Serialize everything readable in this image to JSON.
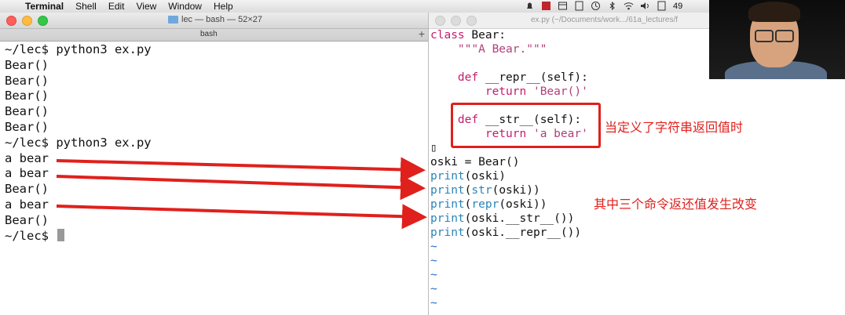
{
  "menubar": {
    "app": "Terminal",
    "items": [
      "Shell",
      "Edit",
      "View",
      "Window",
      "Help"
    ],
    "battery": "49"
  },
  "terminal": {
    "window_title": "lec — bash — 52×27",
    "tab_title": "bash",
    "lines": [
      "~/lec$ python3 ex.py",
      "Bear()",
      "Bear()",
      "Bear()",
      "Bear()",
      "Bear()",
      "~/lec$ python3 ex.py",
      "a bear",
      "a bear",
      "Bear()",
      "a bear",
      "Bear()"
    ],
    "prompt": "~/lec$ "
  },
  "editor": {
    "window_title": "ex.py (~/Documents/work.../61a_lectures/f"
  },
  "annotations": {
    "note1": "当定义了字符串返回值时",
    "note2": "其中三个命令返还值发生改变"
  },
  "colors": {
    "annotation_red": "#e0201c",
    "keyword": "#c51b6e",
    "builtin": "#2a84b5",
    "vim_tilde": "#2a6cc8"
  }
}
